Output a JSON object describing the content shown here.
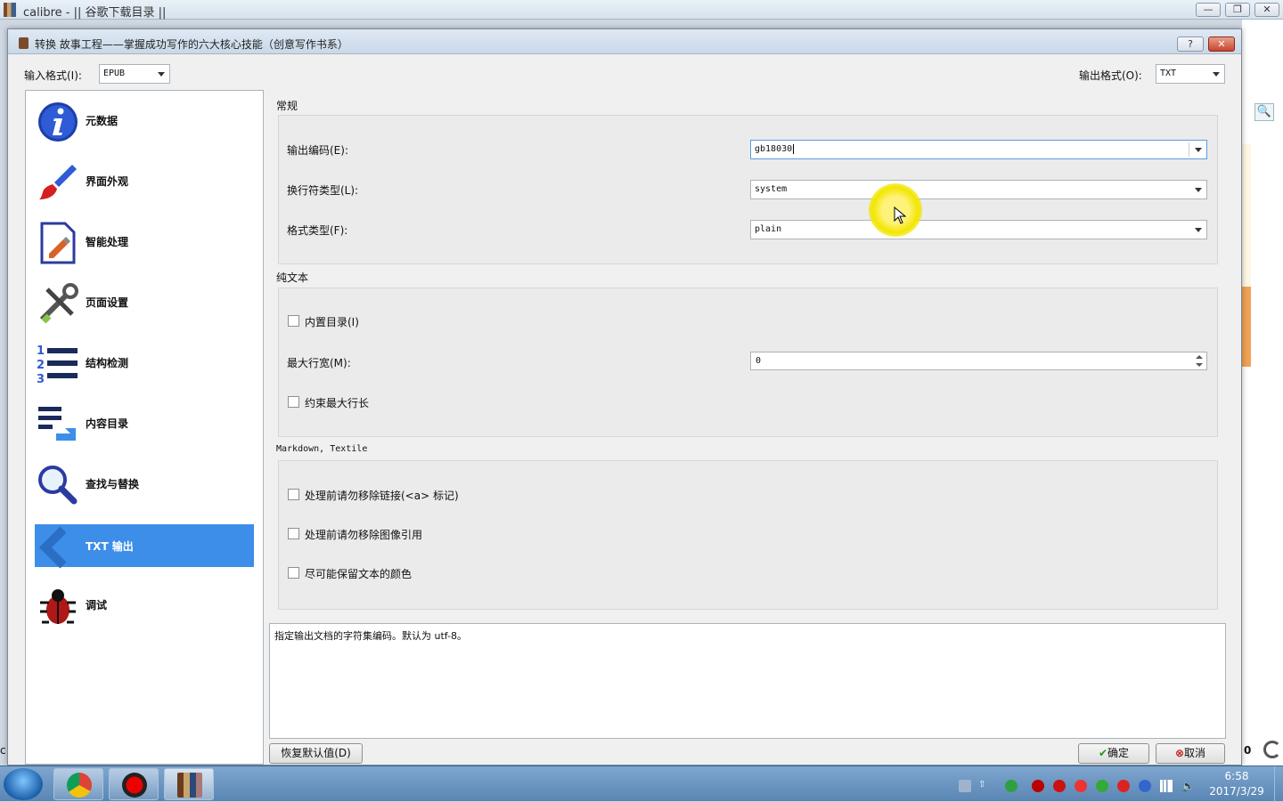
{
  "main_window": {
    "title": "calibre - || 谷歌下载目录 ||",
    "buttons": {
      "minimize": "—",
      "restore": "❐",
      "close": "✕"
    }
  },
  "dialog": {
    "title": "转换 故事工程——掌握成功写作的六大核心技能（创意写作书系）",
    "help_btn": "?",
    "close_btn": "✕",
    "input_format": {
      "label": "输入格式(I):",
      "value": "EPUB"
    },
    "output_format": {
      "label": "输出格式(O):",
      "value": "TXT"
    },
    "sidebar": {
      "items": [
        {
          "label": "元数据",
          "icon": "info-icon"
        },
        {
          "label": "界面外观",
          "icon": "brush-icon"
        },
        {
          "label": "智能处理",
          "icon": "document-edit-icon"
        },
        {
          "label": "页面设置",
          "icon": "tools-icon"
        },
        {
          "label": "结构检测",
          "icon": "numbered-list-icon"
        },
        {
          "label": "内容目录",
          "icon": "toc-icon"
        },
        {
          "label": "查找与替换",
          "icon": "magnifier-icon"
        },
        {
          "label": "TXT 输出",
          "icon": "chevron-left-icon",
          "selected": true
        },
        {
          "label": "调试",
          "icon": "bug-icon"
        }
      ]
    },
    "general": {
      "title": "常规",
      "encoding": {
        "label": "输出编码(E):",
        "value": "gb18030"
      },
      "newline": {
        "label": "换行符类型(L):",
        "value": "system"
      },
      "format": {
        "label": "格式类型(F):",
        "value": "plain"
      }
    },
    "plain_text": {
      "title": "纯文本",
      "inline_toc": "内置目录(I)",
      "max_line": {
        "label": "最大行宽(M):",
        "value": "0"
      },
      "force_max": "约束最大行长"
    },
    "markdown": {
      "title": "Markdown, Textile",
      "keep_links": "处理前请勿移除链接(<a> 标记)",
      "keep_images": "处理前请勿移除图像引用",
      "keep_color": "尽可能保留文本的颜色"
    },
    "help_text": "指定输出文档的字符集编码。默认为 utf-8。",
    "restore_defaults": "恢复默认值(D)",
    "ok": "确定",
    "cancel": "取消"
  },
  "background": {
    "left_letter": "c",
    "right_count": "0"
  },
  "taskbar": {
    "clock_time": "6:58",
    "clock_date": "2017/3/29"
  }
}
